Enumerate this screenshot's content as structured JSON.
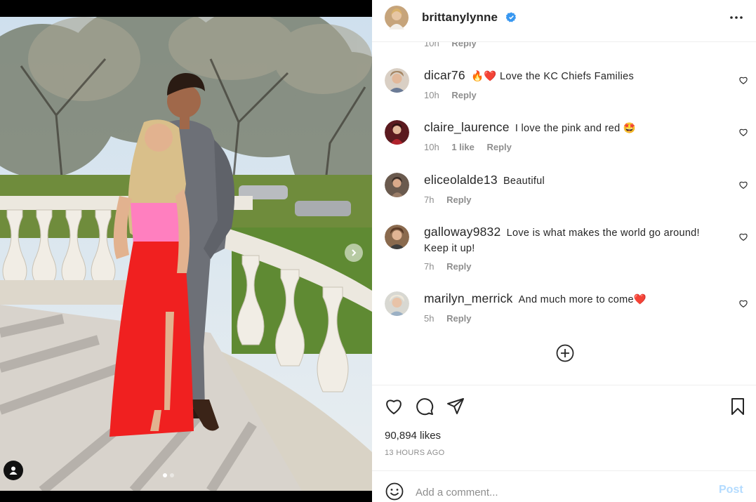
{
  "post": {
    "username": "brittanylynne",
    "verified": true,
    "likes_text": "90,894 likes",
    "time_ago": "13 HOURS AGO",
    "slide_count": 2,
    "active_slide": 0
  },
  "partial_comment": {
    "time": "10h",
    "reply": "Reply"
  },
  "comments": [
    {
      "user": "dicar76",
      "text": "🔥❤️ Love the KC Chiefs Families",
      "time": "10h",
      "likes": "",
      "reply": "Reply"
    },
    {
      "user": "claire_laurence",
      "text": "I love the pink and red 🤩",
      "time": "10h",
      "likes": "1 like",
      "reply": "Reply"
    },
    {
      "user": "eliceolalde13",
      "text": "Beautiful",
      "time": "7h",
      "likes": "",
      "reply": "Reply"
    },
    {
      "user": "galloway9832",
      "text": "Love is what makes the world go around! Keep it up!",
      "time": "7h",
      "likes": "",
      "reply": "Reply"
    },
    {
      "user": "marilyn_merrick",
      "text": "And much more to come❤️",
      "time": "5h",
      "likes": "",
      "reply": "Reply"
    }
  ],
  "composer": {
    "placeholder": "Add a comment...",
    "post_label": "Post"
  },
  "colors": {
    "verified_blue": "#3897f0",
    "post_disabled": "#b3dbff",
    "heart_red": "#ed4956"
  },
  "icons": [
    "more-icon",
    "heart-icon",
    "comment-icon",
    "share-icon",
    "bookmark-icon",
    "plus-circle-icon",
    "emoji-icon",
    "next-arrow-icon",
    "user-tag-icon"
  ]
}
